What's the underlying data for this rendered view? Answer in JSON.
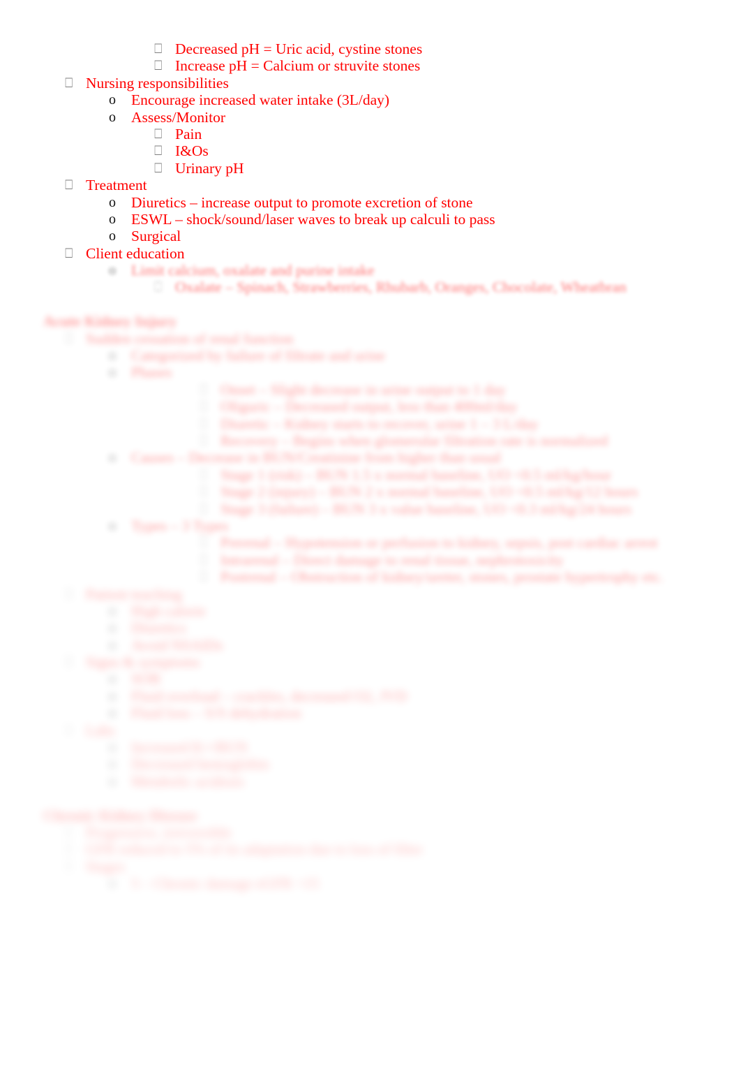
{
  "document": {
    "type": "outline-notes",
    "text_color": "#FF0000",
    "bullet_color": "#1A1A1A",
    "background": "#FFFFFF",
    "bullet_glyphs": {
      "level1": "⎕",
      "level2": "o",
      "level3": "⎕",
      "level4": "⎕"
    }
  },
  "outline": {
    "stones_ph": [
      {
        "text": "Decreased pH = Uric acid, cystine stones"
      },
      {
        "text": "Increase pH = Calcium or struvite stones"
      }
    ],
    "nursing_responsibilities": {
      "label": "Nursing responsibilities",
      "items": [
        {
          "text": "Encourage increased water intake (3L/day)"
        },
        {
          "text": "Assess/Monitor"
        }
      ],
      "assess_monitor": [
        {
          "text": "Pain"
        },
        {
          "text": "I&Os"
        },
        {
          "text": "Urinary pH"
        }
      ]
    },
    "treatment": {
      "label": "Treatment",
      "items": [
        {
          "text": "Diuretics – increase output to promote excretion of stone"
        },
        {
          "text": "ESWL – shock/sound/laser waves to break up calculi to pass"
        },
        {
          "text": "Surgical"
        }
      ]
    },
    "client_education": {
      "label": "Client education",
      "items": [
        {
          "text": "Limit calcium, oxalate and purine intake"
        }
      ],
      "subitems": [
        {
          "text": "Oxalate – Spinach, Strawberries, Rhubarb, Oranges, Chocolate, Wheatbran"
        }
      ]
    }
  },
  "section_aki": {
    "heading": "Acute Kidney Injury",
    "definition": {
      "label": "Sudden cessation of renal function",
      "items": [
        {
          "text": "Categorized by failure of filtrate and urine"
        },
        {
          "text": "Phases"
        }
      ],
      "phases": [
        {
          "text": "Onset – Slight decrease in urine output to 1 day"
        },
        {
          "text": "Oliguric – Decreased output, less than 400ml/day"
        },
        {
          "text": "Diuretic – Kidney starts to recover, urine 1 – 3 L/day"
        },
        {
          "text": "Recovery – Begins when glomerular filtration rate is normalized"
        }
      ],
      "causes_label": "Causes – Decrease in BUN/Creatinine from higher than usual",
      "causes": [
        {
          "text": "Stage 1 (risk) – BUN 1.5 x normal baseline, UO <0.5 ml/kg/hour"
        },
        {
          "text": "Stage 2 (injury) – BUN 2 x normal baseline, UO <0.5 ml/kg/12 hours"
        },
        {
          "text": "Stage 3 (failure) – BUN 3 x value baseline, UO <0.3 ml/kg/24 hours"
        }
      ],
      "types_label": "Types – 3 Types",
      "types": [
        {
          "text": "Prerenal – Hypotension or perfusion to kidney, sepsis, post cardiac arrest"
        },
        {
          "text": "Intrarenal – Direct damage to renal tissue, nephrotoxicity"
        },
        {
          "text": "Postrenal – Obstruction of kidney/ureter, stones, prostate hypertrophy etc."
        }
      ]
    },
    "patient_teaching": {
      "label": "Patient teaching",
      "items": [
        {
          "text": "High calorie"
        },
        {
          "text": "Diuretics"
        },
        {
          "text": "Avoid NSAIDs"
        }
      ]
    },
    "signs_symptoms": {
      "label": "Signs & symptoms",
      "items": [
        {
          "text": "SOB"
        },
        {
          "text": "Fluid overload – crackles, decreased O2, JVD"
        },
        {
          "text": "Fluid loss – S/S dehydration"
        }
      ]
    },
    "labs": {
      "label": "Labs",
      "items": [
        {
          "text": "Increased K+/BUN"
        },
        {
          "text": "Decreased hemoglobin"
        },
        {
          "text": "Metabolic acidosis"
        }
      ]
    }
  },
  "section_ckd": {
    "heading": "Chronic Kidney Disease",
    "items": [
      {
        "text": "Progressive, irreversible"
      },
      {
        "text": "GFR reduced to 5% of its adaptation due to loss of filter"
      },
      {
        "text": "Stages"
      }
    ],
    "stages": [
      {
        "text": "5 – Chronic damage eGFR <15"
      }
    ]
  }
}
